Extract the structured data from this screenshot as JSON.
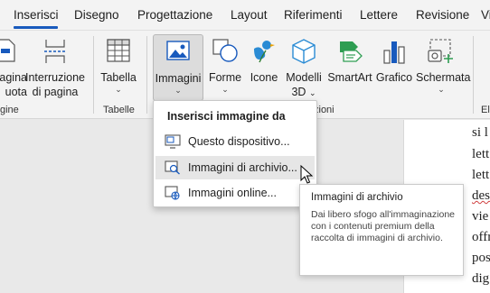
{
  "tabs": [
    {
      "label": "Inserisci",
      "active": true
    },
    {
      "label": "Disegno"
    },
    {
      "label": "Progettazione"
    },
    {
      "label": "Layout"
    },
    {
      "label": "Riferimenti"
    },
    {
      "label": "Lettere"
    },
    {
      "label": "Revisione"
    },
    {
      "label": "Vi"
    }
  ],
  "ribbon": {
    "page_button": {
      "line1": "agina",
      "line2": "uota"
    },
    "page_break": {
      "line1": "Interruzione",
      "line2": "di pagina"
    },
    "table": {
      "label": "Tabella"
    },
    "images": {
      "label": "Immagini"
    },
    "shapes": {
      "label": "Forme"
    },
    "icons": {
      "label": "Icone"
    },
    "models3d": {
      "line1": "Modelli",
      "line2": "3D"
    },
    "smartart": {
      "label": "SmartArt"
    },
    "chart": {
      "label": "Grafico"
    },
    "screenshot": {
      "label": "Schermata"
    },
    "groups": {
      "pages": "gine",
      "tables": "Tabelle",
      "illustrations": "zioni",
      "right": "El"
    },
    "accent_color": "#185abd"
  },
  "dropdown": {
    "title": "Inserisci immagine da",
    "items": [
      {
        "label": "Questo dispositivo...",
        "icon": "device-icon"
      },
      {
        "label": "Immagini di archivio...",
        "icon": "stock-images-icon",
        "hover": true
      },
      {
        "label": "Immagini online...",
        "icon": "online-images-icon"
      }
    ]
  },
  "tooltip": {
    "title": "Immagini di archivio",
    "body": "Dai libero sfogo all'immaginazione con i contenuti premium della raccolta di immagini di archivio."
  },
  "document": {
    "lines": [
      "si l",
      "lett",
      "lett",
      "des",
      "vie",
      "offr",
      "pos",
      "dig"
    ]
  }
}
